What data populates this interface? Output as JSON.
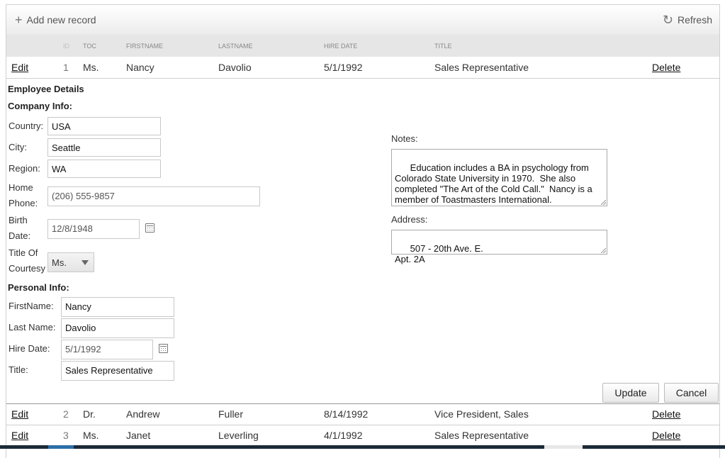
{
  "toolbar": {
    "add_label": "Add new record",
    "refresh_label": "Refresh"
  },
  "columns": {
    "id": "ID",
    "toc": "TOC",
    "firstname": "FIRSTNAME",
    "lastname": "LASTNAME",
    "hire_date": "HIRE DATE",
    "title": "TITLE"
  },
  "rows": [
    {
      "edit": "Edit",
      "id": "1",
      "toc": "Ms.",
      "firstname": "Nancy",
      "lastname": "Davolio",
      "hire_date": "5/1/1992",
      "title": "Sales Representative",
      "delete": "Delete"
    },
    {
      "edit": "Edit",
      "id": "2",
      "toc": "Dr.",
      "firstname": "Andrew",
      "lastname": "Fuller",
      "hire_date": "8/14/1992",
      "title": "Vice President, Sales",
      "delete": "Delete"
    },
    {
      "edit": "Edit",
      "id": "3",
      "toc": "Ms.",
      "firstname": "Janet",
      "lastname": "Leverling",
      "hire_date": "4/1/1992",
      "title": "Sales Representative",
      "delete": "Delete"
    }
  ],
  "detail": {
    "heading": "Employee Details",
    "company_heading": "Company Info:",
    "personal_heading": "Personal Info:",
    "country_label": "Country:",
    "country_value": "USA",
    "city_label": "City:",
    "city_value": "Seattle",
    "region_label": "Region:",
    "region_value": "WA",
    "home_label_1": "Home",
    "home_label_2": "Phone:",
    "home_value": "(206) 555-9857",
    "birth_label_1": "Birth",
    "birth_label_2": "Date:",
    "birth_value": "12/8/1948",
    "toc_label_1": "Title Of",
    "toc_label_2": "Courtesy",
    "toc_value": "Ms.",
    "firstname_label": "FirstName:",
    "firstname_value": "Nancy",
    "lastname_label": "Last Name:",
    "lastname_value": "Davolio",
    "hiredate_label": "Hire Date:",
    "hiredate_value": "5/1/1992",
    "title_label": "Title:",
    "title_value": "Sales Representative",
    "notes_label": "Notes:",
    "notes_value": "Education includes a BA in psychology from\nColorado State University in 1970.  She also\ncompleted \"The Art of the Cold Call.\"  Nancy is a\nmember of Toastmasters International.",
    "address_label": "Address:",
    "address_value": "507 - 20th Ave. E.\nApt. 2A",
    "update_label": "Update",
    "cancel_label": "Cancel"
  },
  "icons": {
    "add": "plus-icon",
    "refresh": "refresh-icon",
    "calendar": "calendar-icon",
    "dropdown": "chevron-down-icon"
  }
}
